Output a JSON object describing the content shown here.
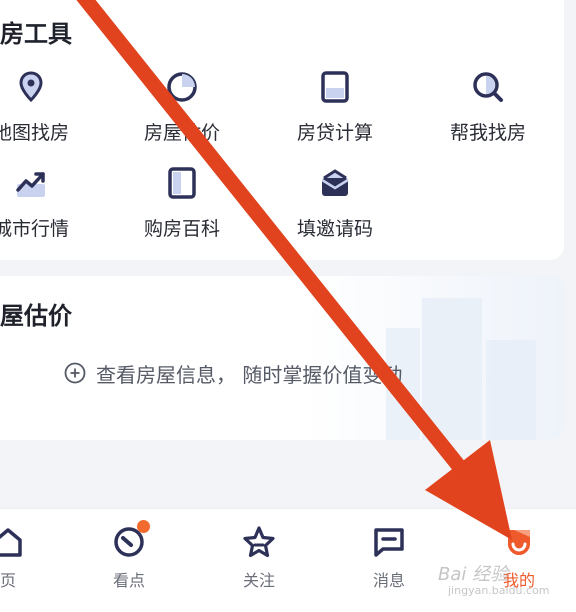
{
  "tools_section": {
    "title": "房工具",
    "items": [
      {
        "label": "地图找房",
        "icon": "map-pin-icon"
      },
      {
        "label": "房屋估价",
        "icon": "pie-chart-icon"
      },
      {
        "label": "房贷计算",
        "icon": "calculator-icon"
      },
      {
        "label": "帮我找房",
        "icon": "search-house-icon"
      },
      {
        "label": "城市行情",
        "icon": "trend-icon"
      },
      {
        "label": "购房百科",
        "icon": "book-icon"
      },
      {
        "label": "填邀请码",
        "icon": "envelope-icon"
      }
    ]
  },
  "valuation_section": {
    "title": "屋估价",
    "hint": "查看房屋信息， 随时掌握价值变动"
  },
  "tabbar": {
    "items": [
      {
        "label": "页",
        "icon": "home-icon"
      },
      {
        "label": "看点",
        "icon": "compass-icon"
      },
      {
        "label": "关注",
        "icon": "star-icon"
      },
      {
        "label": "消息",
        "icon": "message-icon"
      },
      {
        "label": "我的",
        "icon": "profile-icon"
      }
    ]
  },
  "colors": {
    "accent": "#ef5a2c",
    "icon_navy": "#2d3158",
    "icon_light": "#c9d3ef",
    "arrow": "#e2431f"
  },
  "watermark": {
    "text": "Bai 经验",
    "sub": "jingyan.baidu.com"
  }
}
